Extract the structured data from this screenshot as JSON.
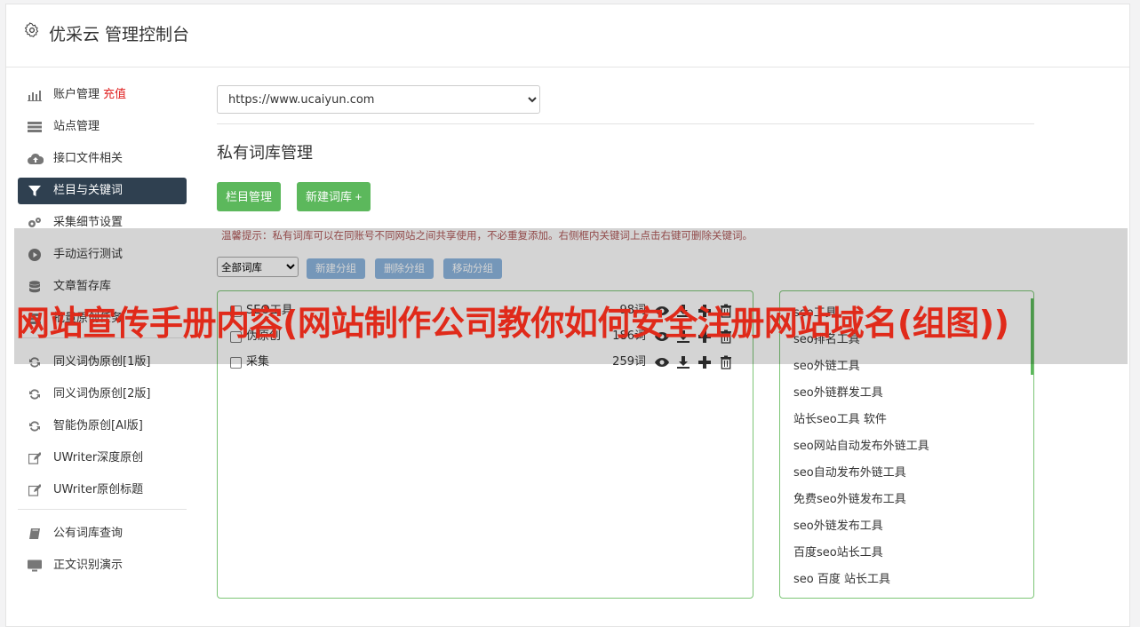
{
  "header": {
    "title": "优采云 管理控制台"
  },
  "sidebar": {
    "items": [
      {
        "label": "账户管理",
        "extra": "充值",
        "icon": "bar-chart-icon"
      },
      {
        "label": "站点管理",
        "icon": "server-icon"
      },
      {
        "label": "接口文件相关",
        "icon": "cloud-upload-icon"
      },
      {
        "label": "栏目与关键词",
        "icon": "filter-icon",
        "active": true
      },
      {
        "label": "采集细节设置",
        "icon": "gears-icon"
      },
      {
        "label": "手动运行测试",
        "icon": "play-circle-icon"
      },
      {
        "label": "文章暂存库",
        "icon": "database-icon"
      },
      {
        "label": "批量原创任务",
        "icon": "tasks-icon"
      },
      {
        "label": "同义词伪原创[1版]",
        "icon": "refresh-icon"
      },
      {
        "label": "同义词伪原创[2版]",
        "icon": "refresh-icon"
      },
      {
        "label": "智能伪原创[AI版]",
        "icon": "refresh-icon"
      },
      {
        "label": "UWriter深度原创",
        "icon": "edit-icon"
      },
      {
        "label": "UWriter原创标题",
        "icon": "edit-icon"
      },
      {
        "label": "公有词库查询",
        "icon": "book-icon"
      },
      {
        "label": "正文识别演示",
        "icon": "monitor-icon"
      }
    ]
  },
  "main": {
    "site_select": "https://www.ucaiyun.com",
    "section_title": "私有词库管理",
    "buttons": {
      "column_manage": "栏目管理",
      "new_lib": "新建词库 +"
    },
    "tip": "温馨提示：私有词库可以在同账号不同网站之间共享使用，不必重复添加。右侧框内关键词上点击右键可删除关键词。",
    "lib_filter": "全部词库",
    "group_buttons": {
      "new_group": "新建分组",
      "delete_group": "删除分组",
      "move_group": "移动分组"
    },
    "libraries": [
      {
        "name": "SEO工具",
        "count": "98词"
      },
      {
        "name": "伪原创",
        "count": "186词"
      },
      {
        "name": "采集",
        "count": "259词"
      }
    ],
    "keywords": [
      "seo工具",
      "seo排名工具",
      "seo外链工具",
      "seo外链群发工具",
      "站长seo工具 软件",
      "seo网站自动发布外链工具",
      "seo自动发布外链工具",
      "免费seo外链发布工具",
      "seo外链发布工具",
      "百度seo站长工具",
      "seo 百度 站长工具"
    ]
  },
  "overlay": {
    "text": "网站宣传手册内容(网站制作公司教你如何安全注册网站域名(组图))"
  }
}
